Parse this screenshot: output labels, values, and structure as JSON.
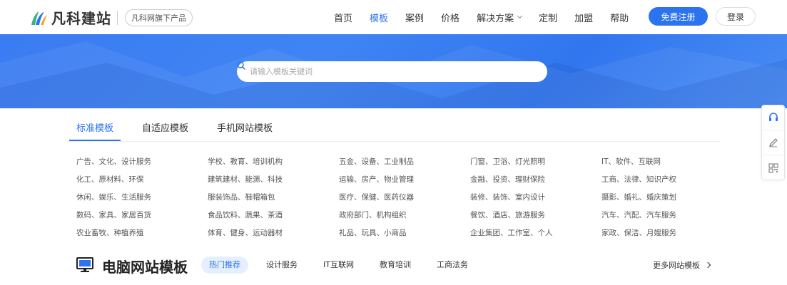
{
  "brand": {
    "name": "凡科建站",
    "badge": "凡科网旗下产品",
    "colors": {
      "green": "#36b37e",
      "blue": "#2c73f0",
      "orange": "#f5a623"
    }
  },
  "nav": {
    "items": [
      {
        "label": "首页",
        "active": false
      },
      {
        "label": "模板",
        "active": true
      },
      {
        "label": "案例",
        "active": false
      },
      {
        "label": "价格",
        "active": false
      },
      {
        "label": "解决方案",
        "active": false,
        "dropdown": true
      },
      {
        "label": "定制",
        "active": false
      },
      {
        "label": "加盟",
        "active": false
      },
      {
        "label": "帮助",
        "active": false
      }
    ],
    "register_label": "免费注册",
    "login_label": "登录"
  },
  "search": {
    "placeholder": "请输入模板关键词",
    "icon": "search-icon"
  },
  "category_tabs": [
    {
      "label": "标准模板",
      "active": true
    },
    {
      "label": "自适应模板",
      "active": false
    },
    {
      "label": "手机网站模板",
      "active": false
    }
  ],
  "categories": [
    "广告、文化、设计服务",
    "学校、教育、培训机构",
    "五金、设备、工业制品",
    "门窗、卫浴、灯光照明",
    "IT、软件、互联网",
    "化工、原材料、环保",
    "建筑建材、能源、科技",
    "运输、房产、物业管理",
    "金融、投资、理财保险",
    "工商、法律、知识产权",
    "休闲、娱乐、生活服务",
    "服装饰品、鞋帽箱包",
    "医疗、保健、医药仪器",
    "装修、装饰、室内设计",
    "摄影、婚礼、婚庆策划",
    "数码、家具、家居百货",
    "食品饮料、蔬果、茶酒",
    "政府部门、机构组织",
    "餐饮、酒店、旅游服务",
    "汽车、汽配、汽车服务",
    "农业畜牧、种植养殖",
    "体育、健身、运动器材",
    "礼品、玩具、小商品",
    "企业集团、工作室、个人",
    "家政、保洁、月嫂服务"
  ],
  "section": {
    "title": "电脑网站模板",
    "icon": "monitor-icon",
    "filters": [
      {
        "label": "热门推荐",
        "active": true
      },
      {
        "label": "设计服务",
        "active": false
      },
      {
        "label": "IT互联网",
        "active": false
      },
      {
        "label": "教育培训",
        "active": false
      },
      {
        "label": "工商法务",
        "active": false
      }
    ],
    "more_label": "更多网站模板"
  },
  "side_toolbar": {
    "icons": [
      "headset-icon",
      "pencil-icon",
      "qrcode-icon"
    ]
  }
}
